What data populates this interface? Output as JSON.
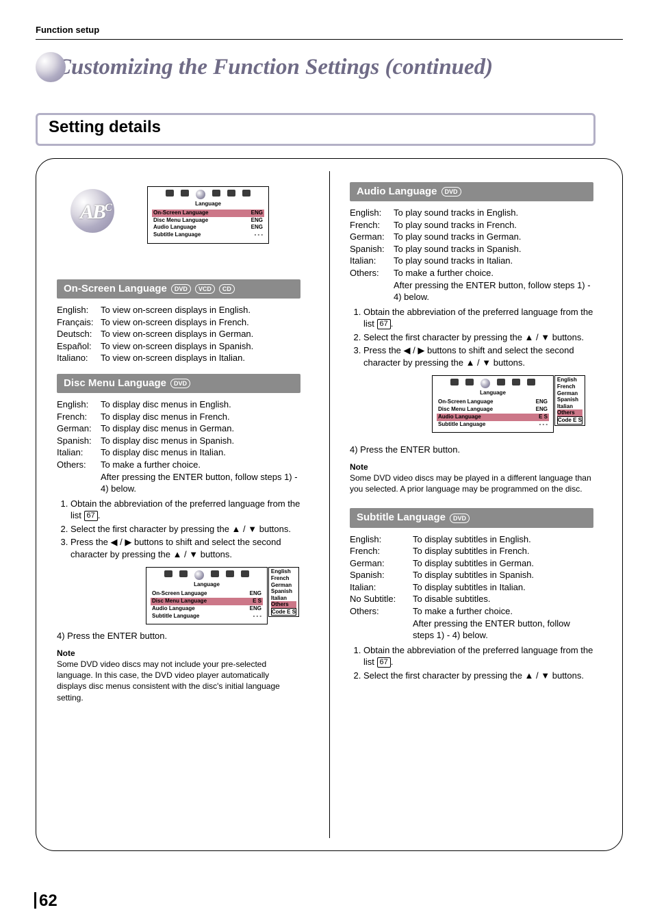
{
  "kicker": "Function setup",
  "bigTitle": "Customizing the Function Settings (continued)",
  "settingHeading": "Setting details",
  "miniPanel": {
    "title": "Language",
    "rows": [
      {
        "label": "On-Screen Language",
        "value": "ENG"
      },
      {
        "label": "Disc Menu Language",
        "value": "ENG"
      },
      {
        "label": "Audio Language",
        "value": "ENG"
      },
      {
        "label": "Subtitle Language",
        "value": "- - -"
      }
    ]
  },
  "miniPanelDisc": {
    "title": "Language",
    "rows": [
      {
        "label": "On-Screen Language",
        "value": "ENG"
      },
      {
        "label": "Disc Menu Language",
        "value": "E S"
      },
      {
        "label": "Audio Language",
        "value": "ENG"
      },
      {
        "label": "Subtitle Language",
        "value": "- - -"
      }
    ],
    "popup": [
      "English",
      "French",
      "German",
      "Spanish",
      "Italian",
      "Others",
      "Code   E  S"
    ]
  },
  "miniPanelAudio": {
    "title": "Language",
    "rows": [
      {
        "label": "On-Screen Language",
        "value": "ENG"
      },
      {
        "label": "Disc Menu Language",
        "value": "ENG"
      },
      {
        "label": "Audio Language",
        "value": "E S"
      },
      {
        "label": "Subtitle Language",
        "value": "- - -"
      }
    ],
    "popup": [
      "English",
      "French",
      "German",
      "Spanish",
      "Italian",
      "Others",
      "Code   E  S"
    ]
  },
  "onScreen": {
    "heading": "On-Screen Language",
    "tags": [
      "DVD",
      "VCD",
      "CD"
    ],
    "items": [
      {
        "term": "English:",
        "desc": "To view on-screen displays in English."
      },
      {
        "term": "Français:",
        "desc": "To view on-screen displays in French."
      },
      {
        "term": "Deutsch:",
        "desc": "To view on-screen displays in German."
      },
      {
        "term": "Español:",
        "desc": "To view on-screen displays in Spanish."
      },
      {
        "term": "Italiano:",
        "desc": "To view on-screen displays in Italian."
      }
    ]
  },
  "discMenu": {
    "heading": "Disc Menu Language",
    "tags": [
      "DVD"
    ],
    "items": [
      {
        "term": "English:",
        "desc": "To display disc menus in English."
      },
      {
        "term": "French:",
        "desc": "To display disc menus in French."
      },
      {
        "term": "German:",
        "desc": "To display disc menus in German."
      },
      {
        "term": "Spanish:",
        "desc": "To display disc menus in Spanish."
      },
      {
        "term": "Italian:",
        "desc": "To display disc menus in Italian."
      },
      {
        "term": "Others:",
        "desc": "To make a further choice."
      }
    ],
    "othersTail": "After pressing the ENTER button, follow steps 1) - 4) below.",
    "steps": [
      "Obtain the abbreviation of the preferred language from the list",
      "Select the first character by pressing the ▲ / ▼ buttons.",
      "Press the ◀ / ▶ buttons to shift and select the second character by pressing the ▲ / ▼ buttons."
    ],
    "pageref": "67",
    "step4": "4)  Press the ENTER button.",
    "noteLabel": "Note",
    "note": "Some DVD video discs may not include your pre-selected language. In this case, the DVD video player automatically displays disc menus consistent with the disc's initial language setting."
  },
  "audio": {
    "heading": "Audio Language",
    "tags": [
      "DVD"
    ],
    "items": [
      {
        "term": "English:",
        "desc": "To play sound tracks in English."
      },
      {
        "term": "French:",
        "desc": "To play sound tracks in French."
      },
      {
        "term": "German:",
        "desc": "To play sound tracks in German."
      },
      {
        "term": "Spanish:",
        "desc": "To play sound tracks in Spanish."
      },
      {
        "term": "Italian:",
        "desc": "To play sound tracks in Italian."
      },
      {
        "term": "Others:",
        "desc": "To make a further choice."
      }
    ],
    "othersTail": "After pressing the ENTER button, follow steps 1) - 4) below.",
    "steps": [
      "Obtain the abbreviation of the preferred language from the list",
      "Select the first character by pressing the ▲ / ▼ buttons.",
      "Press the ◀ / ▶ buttons to shift and select the second character by pressing the ▲ / ▼ buttons."
    ],
    "pageref": "67",
    "step4": "4)  Press the ENTER button.",
    "noteLabel": "Note",
    "note": "Some DVD video discs may be played in a different language than you selected. A prior language may be programmed on the disc."
  },
  "subtitle": {
    "heading": "Subtitle Language",
    "tags": [
      "DVD"
    ],
    "items": [
      {
        "term": "English:",
        "desc": "To display subtitles in English."
      },
      {
        "term": "French:",
        "desc": "To display subtitles in French."
      },
      {
        "term": "German:",
        "desc": "To display subtitles in German."
      },
      {
        "term": "Spanish:",
        "desc": "To display subtitles in Spanish."
      },
      {
        "term": "Italian:",
        "desc": "To display subtitles in Italian."
      },
      {
        "term": "No Subtitle:",
        "desc": "To disable subtitles."
      },
      {
        "term": "Others:",
        "desc": "To make a further choice."
      }
    ],
    "othersTail": "After pressing the ENTER button, follow steps 1) - 4) below.",
    "steps": [
      "Obtain the abbreviation of the preferred language from the list",
      "Select the first character by pressing the ▲ / ▼ buttons."
    ],
    "pageref": "67"
  },
  "pageNumber": "62"
}
